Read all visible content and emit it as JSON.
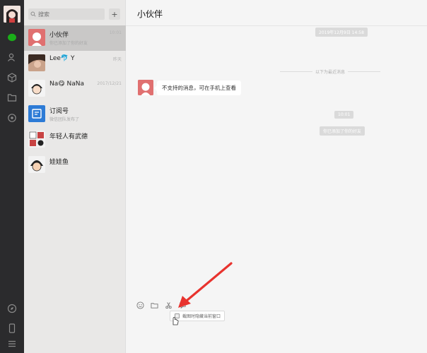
{
  "sidebar": {
    "nav_icons": [
      "chat-icon",
      "contacts-icon",
      "favorites-icon",
      "files-icon",
      "mini-programs-icon",
      "moments-icon",
      "phone-icon",
      "menu-icon"
    ]
  },
  "search": {
    "placeholder": "搜索"
  },
  "add_label": "+",
  "conversations": [
    {
      "name": "小伙伴",
      "time": "10:01",
      "preview": "你已添加了你的好友",
      "active": true
    },
    {
      "name": "Lee🐬 Y",
      "time": "昨天",
      "preview": ""
    },
    {
      "name": "Na😋 NaNa",
      "time": "2017/12/21",
      "preview": ""
    },
    {
      "name": "订阅号",
      "time": "",
      "preview": "微信团队发布了"
    },
    {
      "name": "年轻人有武德",
      "time": "",
      "preview": ""
    },
    {
      "name": "娃娃鱼",
      "time": "",
      "preview": ""
    }
  ],
  "chat": {
    "title": "小伙伴",
    "timestamp": "2019年12月9日 14:58",
    "history_divider": "以下为最近消息",
    "message": "不支持的消息，可在手机上查看",
    "sys_time": "10:01",
    "sys_notice": "你已添加了你的好友"
  },
  "toolbar": {
    "icons": [
      "emoji-icon",
      "folder-icon",
      "scissors-icon",
      "chat-history-icon"
    ]
  },
  "tooltip": {
    "text": "截图时隐藏当前窗口"
  },
  "colors": {
    "rail": "#2b2b2d",
    "list": "#e9e8e7",
    "active": "#c9c8c7",
    "accent_green": "#1aad19",
    "arrow_red": "#e8332e"
  }
}
